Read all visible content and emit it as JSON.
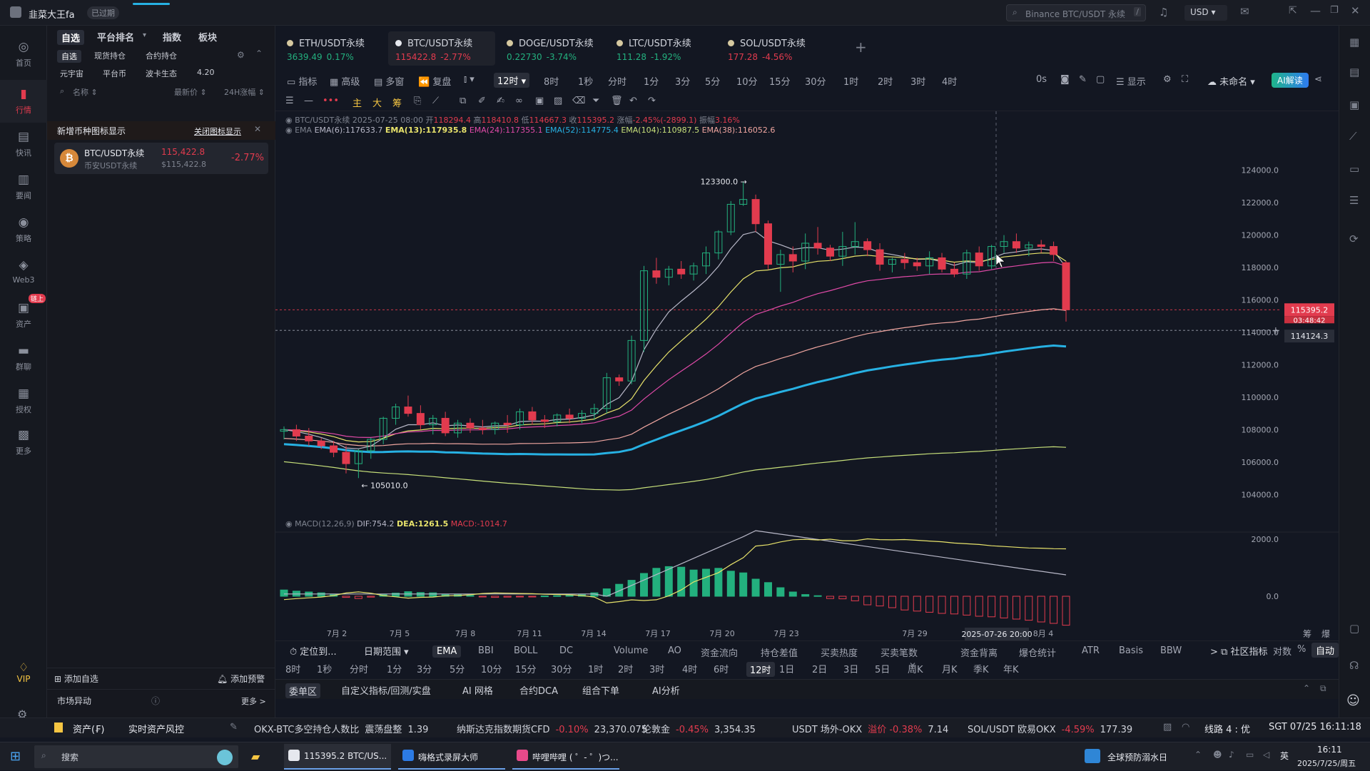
{
  "titlebar": {
    "user": "韭菜大王fa",
    "badge": "已过期",
    "search_placeholder": "Binance BTC/USDT 永续",
    "currency": "USD"
  },
  "leftnav": [
    {
      "label": "首页",
      "icon": "home-icon"
    },
    {
      "label": "行情",
      "icon": "market-icon"
    },
    {
      "label": "快讯",
      "icon": "news-flash-icon"
    },
    {
      "label": "要闻",
      "icon": "headline-icon"
    },
    {
      "label": "策略",
      "icon": "robot-icon"
    },
    {
      "label": "Web3",
      "icon": "web3-icon"
    },
    {
      "label": "资产",
      "icon": "wallet-icon",
      "badge": "链上"
    },
    {
      "label": "群聊",
      "icon": "chat-icon"
    },
    {
      "label": "授权",
      "icon": "auth-icon"
    },
    {
      "label": "更多",
      "icon": "grid-icon"
    }
  ],
  "vip": "VIP",
  "watch": {
    "tabs": [
      "自选",
      "平台排名",
      "指数",
      "板块"
    ],
    "subtabs": [
      "自选",
      "现货持仓",
      "合约持仓"
    ],
    "cats": [
      "元宇宙",
      "平台币",
      "波卡生态",
      "4.20"
    ],
    "cols": {
      "name": "名称",
      "price": "最新价",
      "change": "24H涨幅"
    },
    "notice": "新增币种图标显示",
    "notice_link": "关闭图标显示",
    "item": {
      "name": "BTC/USDT永续",
      "sub": "币安USDT永续",
      "price": "115,422.8",
      "usd": "$115,422.8",
      "change": "-2.77%"
    },
    "add": "添加自选",
    "alert": "添加预警",
    "anomaly": "市场异动",
    "more": "更多 >"
  },
  "tabs": [
    {
      "name": "ETH/USDT永续",
      "price": "3639.49",
      "chg": "0.17%",
      "up": true
    },
    {
      "name": "BTC/USDT永续",
      "price": "115422.8",
      "chg": "-2.77%",
      "up": false
    },
    {
      "name": "DOGE/USDT永续",
      "price": "0.22730",
      "chg": "-3.74%",
      "up": true
    },
    {
      "name": "LTC/USDT永续",
      "price": "111.28",
      "chg": "-1.92%",
      "up": true
    },
    {
      "name": "SOL/USDT永续",
      "price": "177.28",
      "chg": "-4.56%",
      "up": false
    }
  ],
  "toolbar": {
    "ind": "指标",
    "adv": "高级",
    "multi": "多窗",
    "replay": "复盘",
    "tf": "12时",
    "intervals": [
      "8时",
      "1秒",
      "分时",
      "1分",
      "3分",
      "5分",
      "10分",
      "15分",
      "30分",
      "1时",
      "2时",
      "3时",
      "4时"
    ],
    "zero": "0s",
    "show": "显示",
    "unnamed": "未命名",
    "ai": "AI解读"
  },
  "drawbar": [
    "主",
    "大",
    "筹"
  ],
  "ohlc": {
    "pair": "BTC/USDT永续",
    "date": "2025-07-25 08:00",
    "o_label": "开",
    "o": "118294.4",
    "h_label": "高",
    "h": "118410.8",
    "l_label": "低",
    "l": "114667.3",
    "c_label": "收",
    "c": "115395.2",
    "chg_label": "涨幅",
    "chg": "-2.45%(-2899.1)",
    "amp_label": "振幅",
    "amp": "3.16%"
  },
  "ema": {
    "label": "EMA",
    "e6": "EMA(6):117633.7",
    "e13": "EMA(13):117935.8",
    "e24": "EMA(24):117355.1",
    "e52": "EMA(52):114775.4",
    "e104": "EMA(104):110987.5",
    "e38": "EMA(38):116052.6"
  },
  "macd": {
    "label": "MACD(12,26,9)",
    "dif": "DIF:754.2",
    "dea": "DEA:1261.5",
    "macd": "MACD:-1014.7"
  },
  "price_tags": {
    "last": "115395.2",
    "countdown": "03:48:42",
    "cursor": "114124.3",
    "high": "123300.0",
    "low": "105010.0",
    "cursor_time": "2025-07-26 20:00"
  },
  "chart_data": {
    "type": "candlestick",
    "pair": "BTC/USDT永续",
    "interval": "12时",
    "yticks": [
      124000,
      122000,
      120000,
      118000,
      116000,
      114000,
      112000,
      110000,
      108000,
      106000,
      104000
    ],
    "macd_ticks": [
      "2000.0",
      "0.0"
    ],
    "xticks": [
      "7月 2",
      "7月 5",
      "7月 8",
      "7月 11",
      "7月 14",
      "7月 17",
      "7月 20",
      "7月 23",
      "7月 29",
      "8月 1",
      "8月 4"
    ],
    "ylim": [
      103000,
      125000
    ],
    "candles": [
      [
        107900,
        108200,
        107400,
        108000
      ],
      [
        108000,
        108300,
        107300,
        107600
      ],
      [
        107600,
        108100,
        107000,
        107300
      ],
      [
        107300,
        107500,
        106800,
        107000
      ],
      [
        107000,
        107300,
        106300,
        106600
      ],
      [
        106600,
        107000,
        105300,
        105900
      ],
      [
        105900,
        106800,
        105010,
        106700
      ],
      [
        106700,
        107500,
        106200,
        107400
      ],
      [
        107400,
        108800,
        107100,
        108700
      ],
      [
        108700,
        109600,
        108300,
        109400
      ],
      [
        109400,
        110100,
        108800,
        109000
      ],
      [
        109000,
        109500,
        108000,
        108300
      ],
      [
        108300,
        108900,
        107700,
        108700
      ],
      [
        108700,
        109100,
        107600,
        107800
      ],
      [
        107800,
        108600,
        107500,
        108400
      ],
      [
        108400,
        108700,
        107800,
        108100
      ],
      [
        108100,
        108600,
        107700,
        108000
      ],
      [
        108000,
        108500,
        107700,
        108400
      ],
      [
        108400,
        108900,
        107800,
        108300
      ],
      [
        108300,
        109300,
        108000,
        109100
      ],
      [
        109100,
        109400,
        108300,
        108600
      ],
      [
        108600,
        108900,
        108100,
        108500
      ],
      [
        108500,
        109000,
        108200,
        108900
      ],
      [
        108900,
        109300,
        108400,
        108700
      ],
      [
        108700,
        109200,
        108400,
        109000
      ],
      [
        109000,
        109600,
        108600,
        109300
      ],
      [
        109300,
        111500,
        109000,
        111200
      ],
      [
        111200,
        111400,
        110700,
        111000
      ],
      [
        111000,
        113800,
        110800,
        113500
      ],
      [
        113500,
        118100,
        112800,
        117800
      ],
      [
        117800,
        118600,
        117000,
        117400
      ],
      [
        117400,
        118100,
        116900,
        117900
      ],
      [
        117900,
        118400,
        117300,
        117600
      ],
      [
        117600,
        118300,
        117200,
        118100
      ],
      [
        118100,
        119300,
        117600,
        118900
      ],
      [
        118900,
        120300,
        118500,
        120200
      ],
      [
        120200,
        122100,
        120000,
        121900
      ],
      [
        121900,
        123300,
        121800,
        122200
      ],
      [
        122200,
        122500,
        120200,
        120700
      ],
      [
        120700,
        120900,
        117900,
        118200
      ],
      [
        118200,
        119100,
        116500,
        118800
      ],
      [
        118800,
        119300,
        117700,
        118400
      ],
      [
        118400,
        120100,
        117900,
        119500
      ],
      [
        119500,
        120500,
        118800,
        119200
      ],
      [
        119200,
        119400,
        118400,
        118700
      ],
      [
        118700,
        120200,
        118100,
        119300
      ],
      [
        119300,
        120800,
        118800,
        119600
      ],
      [
        119600,
        119800,
        118700,
        119100
      ],
      [
        119100,
        119500,
        117800,
        118200
      ],
      [
        118200,
        118600,
        117700,
        118500
      ],
      [
        118500,
        118900,
        117900,
        118300
      ],
      [
        118300,
        118600,
        117800,
        118100
      ],
      [
        118100,
        119000,
        117600,
        118600
      ],
      [
        118600,
        118900,
        117700,
        117900
      ],
      [
        117900,
        118300,
        117400,
        117600
      ],
      [
        117600,
        119100,
        117300,
        118900
      ],
      [
        118900,
        119300,
        117800,
        118100
      ],
      [
        118100,
        119400,
        117900,
        119300
      ],
      [
        119300,
        120000,
        118900,
        119600
      ],
      [
        119600,
        120100,
        118900,
        119200
      ],
      [
        119200,
        119600,
        118700,
        119400
      ],
      [
        119400,
        119700,
        118900,
        119300
      ],
      [
        119300,
        119600,
        118400,
        118800
      ],
      [
        118300,
        118400,
        114667,
        115395
      ]
    ],
    "macd_hist": [
      220,
      180,
      150,
      120,
      60,
      -40,
      -80,
      -30,
      60,
      110,
      160,
      130,
      120,
      70,
      60,
      30,
      -20,
      -40,
      -30,
      -20,
      -10,
      10,
      20,
      30,
      60,
      120,
      260,
      420,
      560,
      800,
      980,
      1040,
      1020,
      920,
      950,
      980,
      880,
      820,
      600,
      480,
      300,
      150,
      60,
      20,
      -80,
      -90,
      -160,
      -300,
      -340,
      -400,
      -480,
      -520,
      -560,
      -600,
      -620,
      -660,
      -700,
      -720,
      -760,
      -800,
      -840,
      -900,
      -950,
      -1014.7
    ],
    "series": [
      {
        "name": "EMA(6)",
        "color": "#b8b8c8"
      },
      {
        "name": "EMA(13)",
        "color": "#e8e36b"
      },
      {
        "name": "EMA(24)",
        "color": "#e04aa8"
      },
      {
        "name": "EMA(38)",
        "color": "#f0a6a0"
      },
      {
        "name": "EMA(52)",
        "color": "#27b1e3"
      },
      {
        "name": "EMA(104)",
        "color": "#c7e07a"
      }
    ]
  },
  "bottom": {
    "locate": "定位到...",
    "range": "日期范围",
    "indicators": [
      "EMA",
      "BBI",
      "BOLL",
      "DC",
      "Volume",
      "AO",
      "资金流向",
      "持仓差值",
      "买卖热度",
      "买卖笔数",
      "资金背离",
      "爆仓统计",
      "ATR",
      "Basis",
      "BBW"
    ],
    "community": "社区指标",
    "log": "对数",
    "pct": "%",
    "auto": "自动",
    "tfs": [
      "8时",
      "1秒",
      "分时",
      "1分",
      "3分",
      "5分",
      "10分",
      "15分",
      "30分",
      "1时",
      "2时",
      "3时",
      "4时",
      "6时",
      "12时",
      "1日",
      "2日",
      "3日",
      "5日",
      "周K",
      "月K",
      "季K",
      "年K"
    ],
    "panels": [
      "委单区",
      "自定义指标/回测/实盘",
      "AI 网格",
      "合约DCA",
      "组合下单",
      "AI分析"
    ],
    "chips": [
      "筹",
      "爆"
    ]
  },
  "status": {
    "asset": "资产(₣)",
    "risk": "实时资产风控",
    "items": [
      {
        "name": "OKX-BTC多空持仓人数比",
        "tag": "震荡盘整",
        "val": "1.39"
      },
      {
        "name": "纳斯达克指数期货CFD",
        "tag": "-0.10%",
        "val": "23,370.075"
      },
      {
        "name": "伦敦金",
        "tag": "-0.45%",
        "val": "3,354.35"
      },
      {
        "name": "USDT 场外-OKX",
        "tag": "溢价 -0.38%",
        "val": "7.14"
      },
      {
        "name": "SOL/USDT 欧易OKX",
        "tag": "-4.59%",
        "val": "177.39"
      }
    ],
    "line": "线路 4 : 优",
    "time": "SGT 07/25 16:11:18"
  },
  "taskbar": {
    "search": "搜索",
    "apps": [
      "115395.2 BTC/US...",
      "嗨格式录屏大师",
      "哔哩哔哩 ( ゜- ゜)つ..."
    ],
    "notice": "全球预防溺水日",
    "ime": "英",
    "clock": "16:11",
    "date": "2025/7/25/周五"
  }
}
